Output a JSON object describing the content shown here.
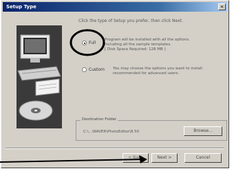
{
  "window": {
    "title": "Setup Type",
    "close_glyph": "×"
  },
  "instruction": "Click the type of Setup you prefer, then click Next.",
  "options": {
    "full": {
      "label": "Full",
      "selected": true,
      "description_lines": [
        "Program will be installed with all the options.",
        "including all the sample templates.",
        "[ Disk Space Required: 128 MB ]"
      ]
    },
    "custom": {
      "label": "Custom",
      "selected": false,
      "description_lines": [
        "You may choose the options you want to install.",
        "recommended for advanced users."
      ]
    }
  },
  "destination": {
    "group_label": "Destination Folder",
    "path": "C:\\...\\NAVER\\PhotoEditor\\8.50",
    "browse_label": "Browse..."
  },
  "footer": {
    "back_label": "< Back",
    "next_label": "Next >",
    "cancel_label": "Cancel"
  },
  "icons": [
    "computer-monitor-icon",
    "keyboard-icon",
    "cd-disc-icon",
    "folder-icon"
  ],
  "annotation": {
    "circle_color": "#000000",
    "arrow_color": "#000000"
  }
}
